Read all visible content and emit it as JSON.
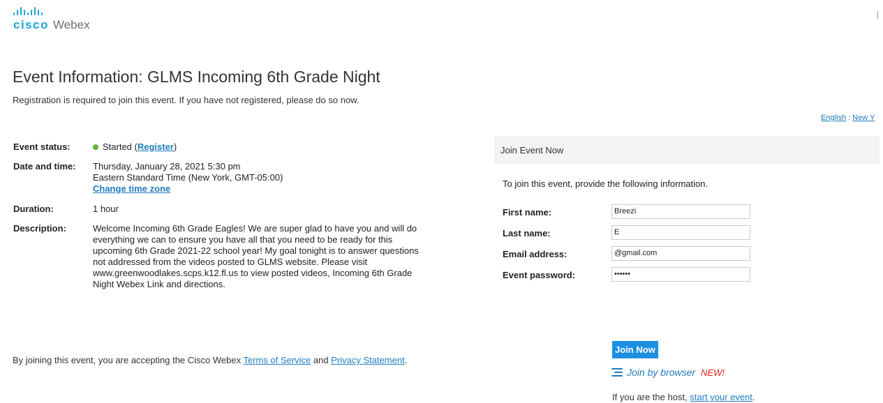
{
  "logo": {
    "brand": "cisco",
    "product": "Webex"
  },
  "event": {
    "title": "Event Information: GLMS Incoming 6th Grade Night",
    "registration_note": "Registration is required to join this event. If you have not registered, please do so now."
  },
  "language": {
    "link": "English",
    "separator": ":",
    "timezone_link": "New Y"
  },
  "details": {
    "status_label": "Event status:",
    "status_value": "Started",
    "register_open": " (",
    "register_link": "Register",
    "register_close": ")",
    "date_label": "Date and time:",
    "date_line1": "Thursday, January 28, 2021 5:30 pm",
    "date_line2": "Eastern Standard Time (New York, GMT-05:00)",
    "change_timezone": "Change time zone",
    "duration_label": "Duration:",
    "duration_value": "1 hour",
    "description_label": "Description:",
    "description_value": "Welcome Incoming 6th Grade Eagles! We are super glad to have you and will do everything we can to ensure you have all that you need to be ready for this upcoming 6th Grade 2021-22 school year! My goal tonight is to answer questions not addressed from the videos posted to GLMS website. Please visit www.greenwoodlakes.scps.k12.fl.us to view posted videos, Incoming 6th Grade Night Webex Link and directions."
  },
  "terms": {
    "prefix": "By joining this event, you are accepting the Cisco Webex ",
    "tos_link": "Terms of Service",
    "and": " and ",
    "privacy_link": "Privacy Statement",
    "suffix": "."
  },
  "join": {
    "header": "Join Event Now",
    "intro": "To join this event, provide the following information.",
    "first_name_label": "First name:",
    "first_name_value": "Breezi",
    "last_name_label": "Last name:",
    "last_name_value": "E",
    "email_label": "Email address:",
    "email_value": "@gmail.com",
    "password_label": "Event password:",
    "password_value": "••••••",
    "join_button": "Join Now",
    "join_browser": "Join by browser",
    "new_badge": "NEW!",
    "host_prefix": "If you are the host, ",
    "host_link": "start your event",
    "host_suffix": "."
  },
  "colors": {
    "accent": "#1d8fe0",
    "link": "#1f7bbd",
    "status_green": "#61b33c",
    "new_red": "#e02020",
    "cisco_blue": "#1aa5d6"
  },
  "icons": {
    "status": "status-dot-icon",
    "browser": "menu-lines-icon",
    "logo": "cisco-bars-logo"
  }
}
